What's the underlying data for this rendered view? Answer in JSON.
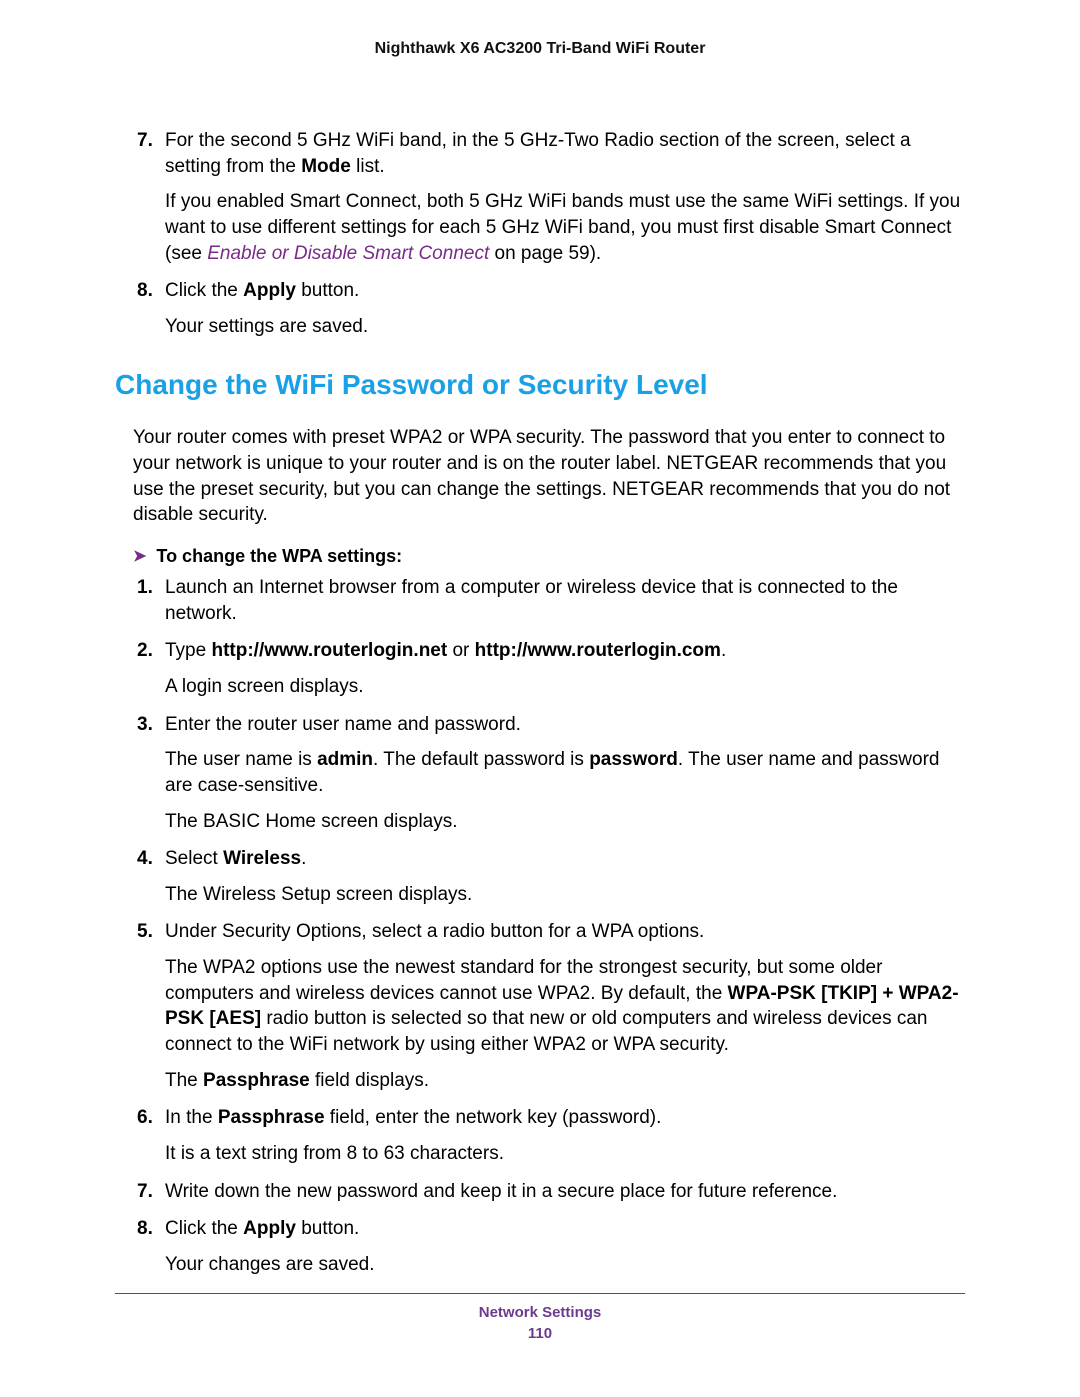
{
  "header": {
    "title": "Nighthawk X6 AC3200 Tri-Band WiFi Router"
  },
  "top_steps": {
    "step7": {
      "num": "7.",
      "line1_a": "For the second 5 GHz WiFi band, in the 5 GHz-Two Radio section of the screen, select a setting from the ",
      "line1_bold": "Mode",
      "line1_b": " list.",
      "line2_a": "If you enabled Smart Connect, both 5 GHz WiFi bands must use the same WiFi settings. If you want to use different settings for each 5 GHz WiFi band, you must first disable Smart Connect (see ",
      "line2_link": "Enable or Disable Smart Connect",
      "line2_b": " on page 59)."
    },
    "step8": {
      "num": "8.",
      "line1_a": "Click the ",
      "line1_bold": "Apply",
      "line1_b": " button.",
      "line2": "Your settings are saved."
    }
  },
  "heading": "Change the WiFi Password or Security Level",
  "intro": "Your router comes with preset WPA2 or WPA security. The password that you enter to connect to your network is unique to your router and is on the router label. NETGEAR recommends that you use the preset security, but you can change the settings. NETGEAR recommends that you do not disable security.",
  "task_title": "To change the WPA settings:",
  "task_steps": [
    {
      "num": "1.",
      "p1": "Launch an Internet browser from a computer or wireless device that is connected to the network."
    },
    {
      "num": "2.",
      "p1_a": "Type ",
      "p1_bold1": "http://www.routerlogin.net",
      "p1_b": " or ",
      "p1_bold2": "http://www.routerlogin.com",
      "p1_c": ".",
      "p2": "A login screen displays."
    },
    {
      "num": "3.",
      "p1": "Enter the router user name and password.",
      "p2_a": "The user name is ",
      "p2_bold1": "admin",
      "p2_b": ". The default password is ",
      "p2_bold2": "password",
      "p2_c": ". The user name and password are case-sensitive.",
      "p3": "The BASIC Home screen displays."
    },
    {
      "num": "4.",
      "p1_a": "Select ",
      "p1_bold": "Wireless",
      "p1_b": ".",
      "p2": "The Wireless Setup screen displays."
    },
    {
      "num": "5.",
      "p1": "Under Security Options, select a radio button for a WPA options.",
      "p2_a": "The WPA2 options use the newest standard for the strongest security, but some older computers and wireless devices cannot use WPA2. By default, the ",
      "p2_bold1": "WPA-PSK [TKIP] + WPA2-PSK [AES]",
      "p2_b": " radio button is selected so that new or old computers and wireless devices can connect to the WiFi network by using either WPA2 or WPA security.",
      "p3_a": "The ",
      "p3_bold": "Passphrase",
      "p3_b": " field displays."
    },
    {
      "num": "6.",
      "p1_a": "In the ",
      "p1_bold": "Passphrase",
      "p1_b": " field, enter the network key (password).",
      "p2": "It is a text string from 8 to 63 characters."
    },
    {
      "num": "7.",
      "p1": "Write down the new password and keep it in a secure place for future reference."
    },
    {
      "num": "8.",
      "p1_a": "Click the ",
      "p1_bold": "Apply",
      "p1_b": " button.",
      "p2": "Your changes are saved."
    }
  ],
  "footer": {
    "section": "Network Settings",
    "page": "110"
  }
}
